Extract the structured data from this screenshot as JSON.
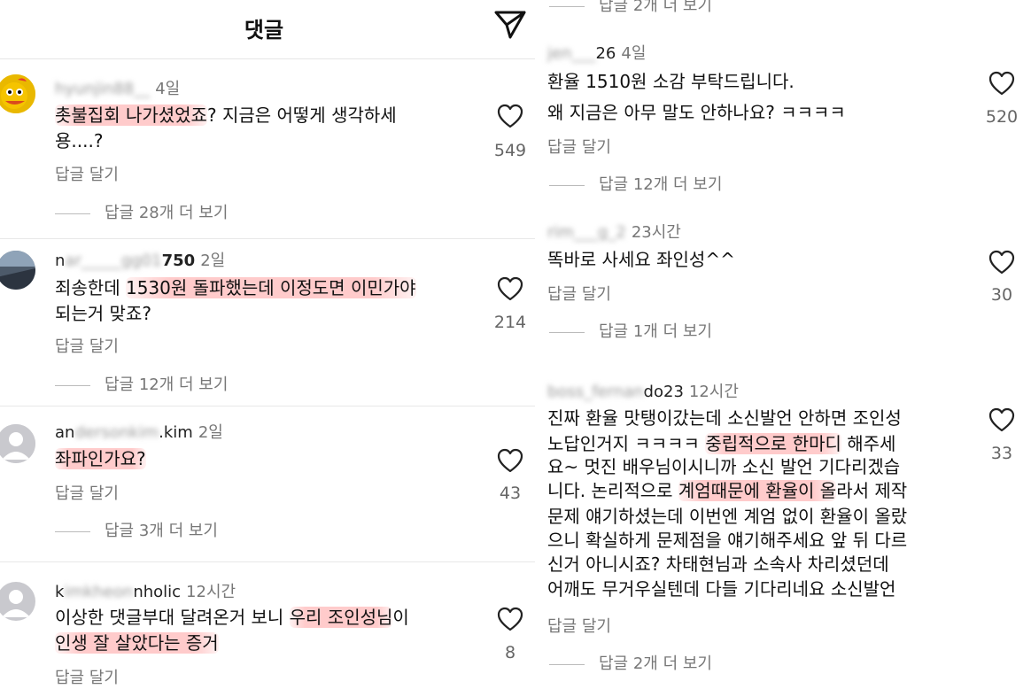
{
  "header": {
    "title": "댓글"
  },
  "left": {
    "comments": [
      {
        "username": "hyunjin88__",
        "time": "4일",
        "lines": [
          [
            "촛불집회 나가셨었죠",
            "?",
            " 지금은 어떻게 생각하세"
          ],
          [
            "용....?"
          ]
        ],
        "reply": "답글 달기",
        "more": "답글 28개 더 보기",
        "likes": "549"
      },
      {
        "username_prefix": "n",
        "username_mid": "ar",
        "username_blur": "_____gg01",
        "username_suffix": "750",
        "time": "2일",
        "lines": [
          [
            "죄송한데 ",
            "1530원 돌파했는데 이정도면 이민가야"
          ],
          [
            "되는거 맞죠?"
          ]
        ],
        "reply": "답글 달기",
        "more": "답글 12개 더 보기",
        "likes": "214"
      },
      {
        "username_prefix": "an",
        "username_blur": "dersonkim",
        "username_suffix": ".kim",
        "time": "2일",
        "lines": [
          [
            "좌파인가요?"
          ]
        ],
        "reply": "답글 달기",
        "more": "답글 3개 더 보기",
        "likes": "43"
      },
      {
        "username_prefix": "k",
        "username_blur": "imkheon",
        "username_suffix": "nholic",
        "time": "12시간",
        "lines": [
          [
            "이상한 댓글부대 달려온거 보니 ",
            "우리 조인성님",
            "이"
          ],
          [
            "인생 잘 살았다는 증거"
          ]
        ],
        "reply": "답글 달기",
        "likes": "8"
      }
    ]
  },
  "right": {
    "top_more": "답글 2개 더 보기",
    "comments": [
      {
        "username_blur": "jen___",
        "username_suffix": "26",
        "time": "4일",
        "lines": [
          "환율 1510원 소감 부탁드립니다.",
          "왜 지금은 아무 말도 안하나요? ㅋㅋㅋㅋ"
        ],
        "reply": "답글 달기",
        "more": "답글 12개 더 보기",
        "likes": "520"
      },
      {
        "username_blur": "rim___g",
        "username_suffix": "_2",
        "time": "23시간",
        "lines": [
          "똑바로 사세요 좌인성^^"
        ],
        "reply": "답글 달기",
        "more": "답글 1개 더 보기",
        "likes": "30"
      },
      {
        "username_blur": "boss_fernan",
        "username_suffix": "do23",
        "time": "12시간",
        "lines": [
          [
            "진짜 환율 맛탱이갔는데 소신발언 안하면 조인성"
          ],
          [
            "노답인거지 ㅋㅋㅋㅋ ",
            "중립적으로 한마디",
            " 해주세"
          ],
          [
            "요~ 멋진 배우님이시니까 소신 발언 기다리겠습"
          ],
          [
            "니다. 논리적으로 ",
            "계엄때문에 환율이 올",
            "라서 제작"
          ],
          [
            "문제 얘기하셨는데 이번엔 계엄 없이 환율이 올랐"
          ],
          [
            "으니 확실하게 문제점을 얘기해주세요 앞 뒤 다르"
          ],
          [
            "신거 아니시죠? 차태현님과 소속사 차리셨던데"
          ],
          [
            "어깨도 무거우실텐데 다들 기다리네요 소신발언"
          ]
        ],
        "reply": "답글 달기",
        "more": "답글 2개 더 보기",
        "likes": "33"
      }
    ]
  },
  "icons": {
    "send": "send-icon",
    "heart": "heart-icon"
  }
}
